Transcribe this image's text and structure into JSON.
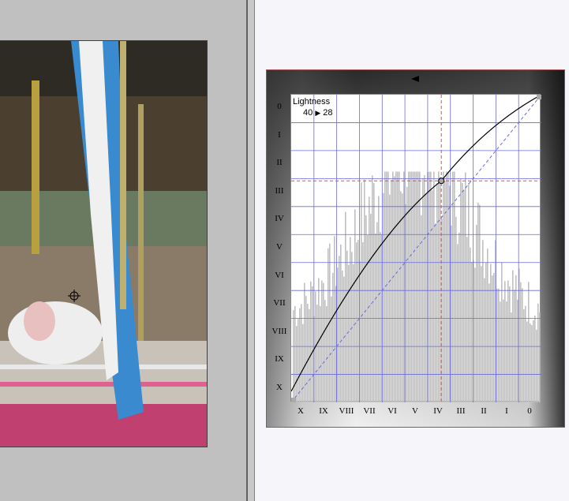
{
  "curves": {
    "channel": "Lightness",
    "input_value": "40",
    "arrow": "▶",
    "output_value": "28",
    "y_ticks": [
      "0",
      "I",
      "II",
      "III",
      "IV",
      "V",
      "VI",
      "VII",
      "VIII",
      "IX",
      "X"
    ],
    "x_ticks": [
      "X",
      "IX",
      "VIII",
      "VII",
      "VI",
      "V",
      "IV",
      "III",
      "II",
      "I",
      "0"
    ],
    "control_point": {
      "input": 40,
      "output": 28
    },
    "colors": {
      "grid": "#6a6ae0",
      "curve": "#000000",
      "crosshair": "#e05050",
      "histogram": "#c0c0c0",
      "diagonal": "#6a6ae0"
    }
  },
  "photo": {
    "subject": "carousel"
  }
}
